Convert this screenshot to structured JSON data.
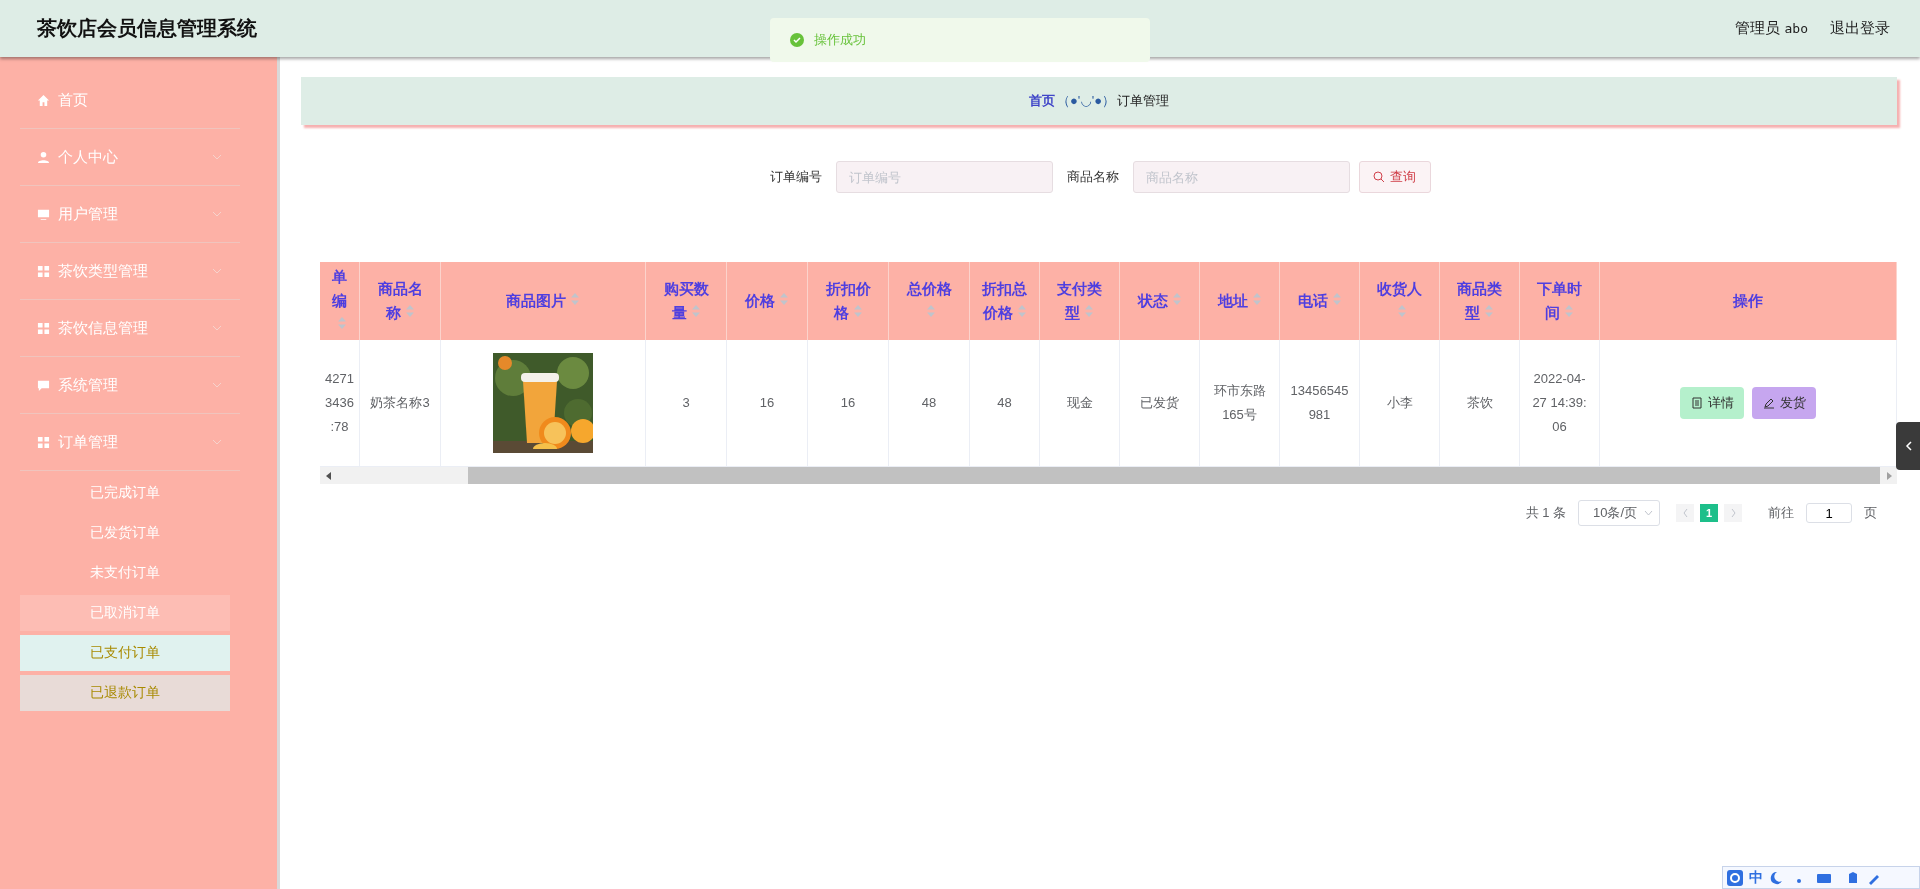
{
  "header": {
    "title": "茶饮店会员信息管理系统",
    "user_role": "管理员",
    "user_name": "abo",
    "logout": "退出登录"
  },
  "toast": {
    "kind": "success",
    "message": "操作成功"
  },
  "sidebar": {
    "items": [
      {
        "label": "首页",
        "kind": "home",
        "submenu": false
      },
      {
        "label": "个人中心",
        "kind": "user",
        "submenu": true
      },
      {
        "label": "用户管理",
        "kind": "monitor",
        "submenu": true
      },
      {
        "label": "茶饮类型管理",
        "kind": "grid",
        "submenu": true
      },
      {
        "label": "茶饮信息管理",
        "kind": "grid",
        "submenu": true
      },
      {
        "label": "系统管理",
        "kind": "chat",
        "submenu": true
      },
      {
        "label": "订单管理",
        "kind": "grid",
        "submenu": true,
        "children": [
          {
            "label": "已完成订单",
            "selected": false,
            "hovered": false,
            "dimmed": false
          },
          {
            "label": "已发货订单",
            "selected": false,
            "hovered": false,
            "dimmed": false
          },
          {
            "label": "未支付订单",
            "selected": false,
            "hovered": false,
            "dimmed": false
          },
          {
            "label": "已取消订单",
            "selected": false,
            "hovered": true,
            "dimmed": false
          },
          {
            "label": "已支付订单",
            "selected": true,
            "hovered": false,
            "dimmed": false
          },
          {
            "label": "已退款订单",
            "selected": false,
            "hovered": false,
            "dimmed": true
          }
        ]
      }
    ]
  },
  "breadcrumb": {
    "home": "首页",
    "separator": "（●'◡'●）",
    "current": "订单管理"
  },
  "search": {
    "fields": [
      {
        "label": "订单编号",
        "placeholder": "订单编号"
      },
      {
        "label": "商品名称",
        "placeholder": "商品名称"
      }
    ],
    "button": "查询"
  },
  "table": {
    "columns": [
      {
        "label": "单编",
        "sortable": true
      },
      {
        "label": "商品名称",
        "sortable": true
      },
      {
        "label": "商品图片",
        "sortable": true
      },
      {
        "label": "购买数量",
        "sortable": true
      },
      {
        "label": "价格",
        "sortable": true
      },
      {
        "label": "折扣价格",
        "sortable": true
      },
      {
        "label": "总价格",
        "sortable": true
      },
      {
        "label": "折扣总价格",
        "sortable": true
      },
      {
        "label": "支付类型",
        "sortable": true
      },
      {
        "label": "状态",
        "sortable": true
      },
      {
        "label": "地址",
        "sortable": true
      },
      {
        "label": "电话",
        "sortable": true
      },
      {
        "label": "收货人",
        "sortable": true
      },
      {
        "label": "商品类型",
        "sortable": true
      },
      {
        "label": "下单时间",
        "sortable": true
      },
      {
        "label": "操作",
        "sortable": false
      }
    ],
    "rows": [
      {
        "cells": [
          {
            "kind": "text",
            "text": "4271\n3436\n:78"
          },
          {
            "kind": "text",
            "text": "奶茶名称3"
          },
          {
            "kind": "picture"
          },
          {
            "kind": "text",
            "text": "3"
          },
          {
            "kind": "text",
            "text": "16"
          },
          {
            "kind": "text",
            "text": "16"
          },
          {
            "kind": "text",
            "text": "48"
          },
          {
            "kind": "text",
            "text": "48"
          },
          {
            "kind": "text",
            "text": "现金"
          },
          {
            "kind": "text",
            "text": "已发货"
          },
          {
            "kind": "text",
            "text": "环市东路165号"
          },
          {
            "kind": "text",
            "text": "13456545981"
          },
          {
            "kind": "text",
            "text": "小李"
          },
          {
            "kind": "text",
            "text": "茶饮"
          },
          {
            "kind": "text",
            "text": "2022-04-27 14:39:06"
          },
          {
            "kind": "actions",
            "buttons": [
              {
                "label": "详情",
                "kind": "detail"
              },
              {
                "label": "发货",
                "kind": "ship"
              }
            ]
          }
        ]
      }
    ]
  },
  "pagination": {
    "total": "共 1 条",
    "page_size": "10条/页",
    "pages": [
      {
        "label": "1",
        "selected": true
      }
    ],
    "goto_label": "前往",
    "goto_value": "1",
    "goto_suffix": "页"
  },
  "ime": {
    "mode": "中"
  }
}
